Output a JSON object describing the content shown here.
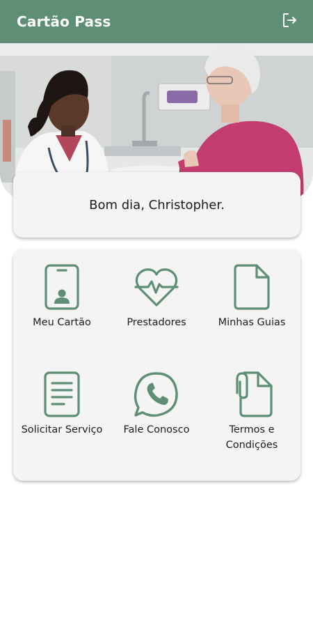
{
  "app": {
    "title": "Cartão Pass"
  },
  "header": {
    "logout_icon": "logout-icon"
  },
  "hero": {
    "image": "doctor-consulting-elderly-patient"
  },
  "greeting": {
    "text": "Bom dia, Christopher."
  },
  "colors": {
    "primary": "#5e8e73",
    "card": "#f4f4f4",
    "icon": "#5e8e73"
  },
  "menu": {
    "items": [
      {
        "label": "Meu Cartão",
        "icon": "id-card-icon"
      },
      {
        "label": "Prestadores",
        "icon": "heart-pulse-icon"
      },
      {
        "label": "Minhas Guias",
        "icon": "document-icon"
      },
      {
        "label": "Solicitar Serviço",
        "icon": "form-icon"
      },
      {
        "label": "Fale Conosco",
        "icon": "whatsapp-icon"
      },
      {
        "label": "Termos e\nCondições",
        "icon": "attachment-document-icon"
      }
    ]
  }
}
